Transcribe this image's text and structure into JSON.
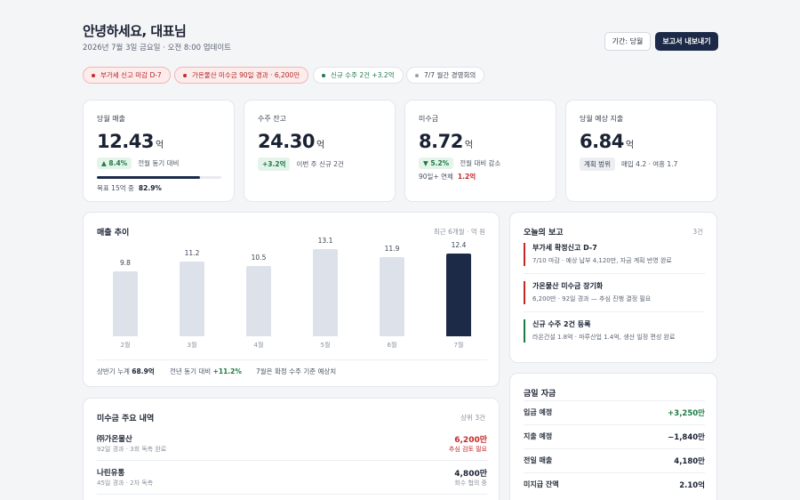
{
  "header": {
    "greeting": "안녕하세요, 대표님",
    "updated": "2026년 7월 3일 금요일 · 오전 8:00 업데이트",
    "period_button": "기간: 당월",
    "export_button": "보고서 내보내기"
  },
  "chips": [
    {
      "label": "부가세 신고 마감 D-7",
      "tone": "red"
    },
    {
      "label": "가온물산 미수금 90일 경과 · 6,200만",
      "tone": "red"
    },
    {
      "label": "신규 수주 2건 +3.2억",
      "tone": "green"
    },
    {
      "label": "7/7 월간 경영회의",
      "tone": "gray"
    }
  ],
  "kpis": {
    "revenue": {
      "label": "당월 매출",
      "value": "12.43",
      "unit": "억",
      "delta": "▲ 8.4%",
      "delta_note": "전월 동기 대비",
      "goal_label": "목표 15억 중",
      "goal_pct": "82.9%",
      "goal_fraction": 0.829
    },
    "backlog": {
      "label": "수주 잔고",
      "value": "24.30",
      "unit": "억",
      "delta": "+3.2억",
      "delta_note": "이번 주 신규 2건"
    },
    "receivables": {
      "label": "미수금",
      "value": "8.72",
      "unit": "억",
      "delta": "▼ 5.2%",
      "delta_note": "전월 대비 감소",
      "overdue_label": "90일+ 연체",
      "overdue_value": "1.2억"
    },
    "expense": {
      "label": "당월 예상 지출",
      "value": "6.84",
      "unit": "억",
      "badge": "계획 범위",
      "note": "매입 4.2 · 여흥 1.7"
    }
  },
  "revenue_trend": {
    "title": "매출 추이",
    "meta": "최근 6개월 · 억 원",
    "footer": {
      "h1_label": "상반기 누계",
      "h1_value": "68.9억",
      "yoy_label": "전년 동기 대비",
      "yoy_value": "+11.2%",
      "note": "7월은 확정 수주 기준 예상치"
    }
  },
  "chart_data": {
    "type": "bar",
    "categories": [
      "2월",
      "3월",
      "4월",
      "5월",
      "6월",
      "7월"
    ],
    "values": [
      9.8,
      11.2,
      10.5,
      13.1,
      11.9,
      12.4
    ],
    "highlight_index": 5,
    "ylim": [
      0,
      14
    ],
    "colors": {
      "default": "#dde2ea",
      "highlight": "#1c2a48"
    }
  },
  "receivables_list": {
    "title": "미수금 주요 내역",
    "meta": "상위 3건",
    "rows": [
      {
        "name": "㈜가온물산",
        "desc": "92일 경과 · 3회 독촉 완료",
        "amount": "6,200만",
        "note": "추심 검토 필요",
        "tone": "red"
      },
      {
        "name": "나린유통",
        "desc": "45일 경과 · 2차 독촉",
        "amount": "4,800만",
        "note": "회수 협의 중",
        "tone": "neutral"
      }
    ]
  },
  "reports": {
    "title": "오늘의 보고",
    "count": "3건",
    "items": [
      {
        "title": "부가세 확정신고 D-7",
        "desc": "7/10 마감 · 예상 납부 4,120만, 자금 계획 반영 완료",
        "color": "#c62828"
      },
      {
        "title": "가온물산 미수금 장기화",
        "desc": "6,200만 · 92일 경과 — 추심 진행 결정 필요",
        "color": "#c62828"
      },
      {
        "title": "신규 수주 2건 등록",
        "desc": "라온건설 1.8억 · 마루산업 1.4억, 생산 일정 편성 완료",
        "color": "#1e7a45"
      }
    ]
  },
  "funds": {
    "title": "금일 자금",
    "rows": [
      {
        "label": "입금 예정",
        "value": "+3,250만",
        "tone": "pos"
      },
      {
        "label": "지출 예정",
        "value": "−1,840만",
        "tone": "neutral"
      },
      {
        "label": "전일 매출",
        "value": "4,180만",
        "tone": "neutral"
      },
      {
        "label": "미지급 잔액",
        "value": "2.10억",
        "tone": "neutral"
      }
    ]
  }
}
